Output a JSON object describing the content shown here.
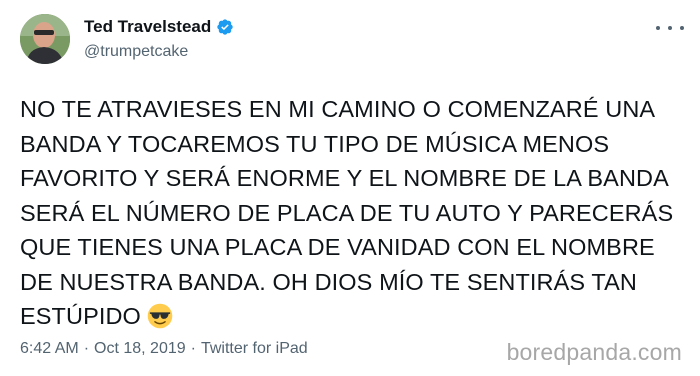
{
  "author": {
    "name": "Ted Travelstead",
    "handle": "@trumpetcake",
    "verified_color": "#1d9bf0"
  },
  "tweet": {
    "lines": [
      "NO TE ATRAVIESES EN MI CAMINO O COMENZARÉ UNA",
      "BANDA Y TOCAREMOS TU TIPO DE MÚSICA MENOS",
      "FAVORITO Y SERÁ ENORME Y EL NOMBRE DE LA BANDA",
      "SERÁ EL NÚMERO DE PLACA DE TU AUTO Y PARECERÁS",
      "QUE TIENES UNA PLACA DE VANIDAD CON EL NOMBRE",
      "DE NUESTRA BANDA. OH DIOS MÍO TE SENTIRÁS TAN",
      "ESTÚPIDO"
    ],
    "emoji": "smiling-face-with-sunglasses"
  },
  "meta": {
    "time": "6:42 AM",
    "separator": "·",
    "date": "Oct 18, 2019",
    "source": "Twitter for iPad"
  },
  "watermark": "boredpanda.com",
  "icons": {
    "more": "more-horizontal-icon",
    "verified": "verified-badge-icon"
  }
}
